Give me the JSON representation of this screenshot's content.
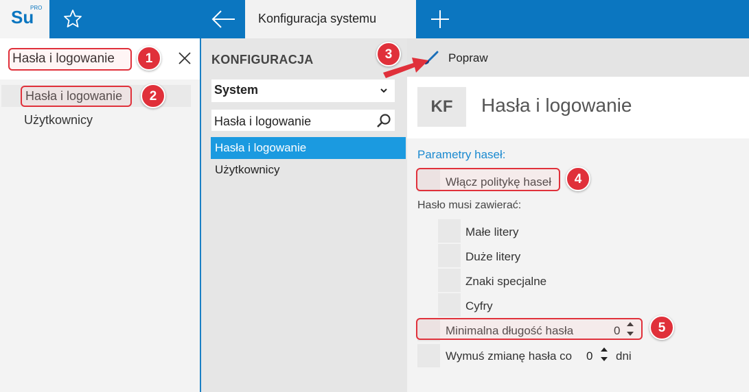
{
  "app": {
    "logo_text": "Su",
    "logo_superscript": "PRO",
    "tab_title": "Konfiguracja systemu"
  },
  "left_panel": {
    "search_value": "Hasła i logowanie",
    "items": [
      {
        "label": "Hasła i logowanie",
        "selected": true
      },
      {
        "label": "Użytkownicy",
        "selected": false
      }
    ]
  },
  "middle_panel": {
    "title": "KONFIGURACJA",
    "dropdown_value": "System",
    "search_value": "Hasła i logowanie",
    "items": [
      {
        "label": "Hasła i logowanie",
        "selected": true
      },
      {
        "label": "Użytkownicy",
        "selected": false
      }
    ]
  },
  "right_panel": {
    "toolbar": {
      "edit_label": "Popraw"
    },
    "badge": "KF",
    "title": "Hasła i logowanie",
    "section": "Parametry haseł:",
    "enable_policy": "Włącz politykę haseł",
    "must_contain": "Hasło musi zawierać:",
    "options": [
      "Małe litery",
      "Duże litery",
      "Znaki specjalne",
      "Cyfry"
    ],
    "min_length_label": "Minimalna długość hasła",
    "min_length_value": "0",
    "force_change_label": "Wymuś zmianę hasła co",
    "force_change_value": "0",
    "force_change_unit": "dni"
  },
  "callouts": [
    "1",
    "2",
    "3",
    "4",
    "5"
  ],
  "colors": {
    "brand": "#0b76c0",
    "selection": "#1b9ae0",
    "callout": "#e0303a"
  },
  "icons": [
    "star-icon",
    "back-arrow-icon",
    "plus-icon",
    "close-icon",
    "chevron-down-icon",
    "search-icon",
    "brush-icon"
  ]
}
